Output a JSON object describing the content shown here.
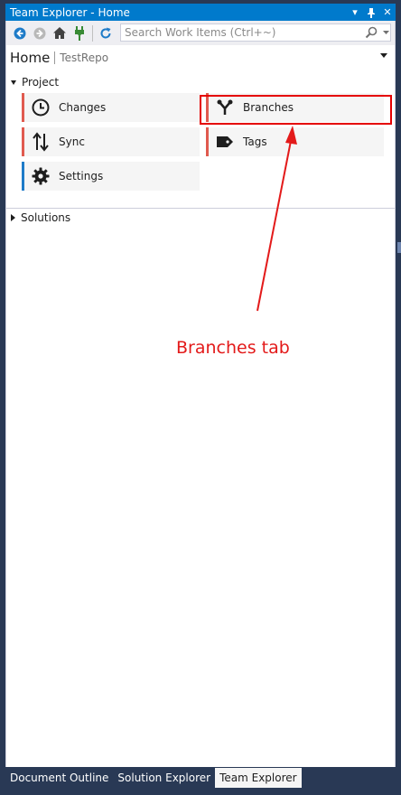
{
  "window": {
    "title": "Team Explorer - Home"
  },
  "titlebar": {
    "dropdown_icon": "dropdown-arrow-icon",
    "pin_icon": "pin-icon",
    "close_icon": "close-icon"
  },
  "toolbar": {
    "icons": [
      "back-arrow-icon",
      "forward-arrow-icon",
      "home-icon",
      "connect-plug-icon",
      "refresh-icon"
    ],
    "search": {
      "placeholder": "Search Work Items (Ctrl+~)",
      "value": ""
    }
  },
  "header": {
    "page": "Home",
    "repo": "TestRepo"
  },
  "project": {
    "label": "Project",
    "tiles": [
      {
        "label": "Changes",
        "icon": "clock-icon",
        "accent": "#e05a4f"
      },
      {
        "label": "Branches",
        "icon": "branch-icon",
        "accent": "#e05a4f"
      },
      {
        "label": "Sync",
        "icon": "sync-arrows-icon",
        "accent": "#e05a4f"
      },
      {
        "label": "Tags",
        "icon": "tag-icon",
        "accent": "#e05a4f"
      },
      {
        "label": "Settings",
        "icon": "gear-icon",
        "accent": "#1e7bc8"
      }
    ]
  },
  "solutions": {
    "label": "Solutions"
  },
  "annotation": {
    "text": "Branches tab",
    "color": "#e31a1a"
  },
  "bottom_tabs": [
    {
      "label": "Document Outline",
      "active": false
    },
    {
      "label": "Solution Explorer",
      "active": false
    },
    {
      "label": "Team Explorer",
      "active": true
    }
  ],
  "colors": {
    "accent_blue": "#007acc",
    "frame": "#293955",
    "highlight": "#e50000"
  }
}
